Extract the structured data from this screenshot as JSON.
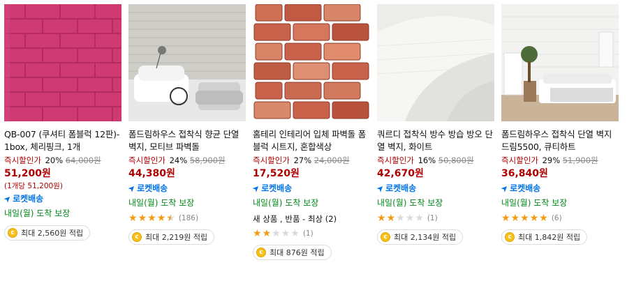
{
  "colors": {
    "sale": "#ae0000",
    "rocket": "#0073e9",
    "arrival": "#00891a",
    "star_on": "#f39b10",
    "star_off": "#dadada"
  },
  "products": [
    {
      "name": "QB-007 (쿠셔티 폼블럭 12판)-1box, 체리핑크, 1개",
      "instant_label": "즉시할인가",
      "discount_rate": "20%",
      "original_price": "64,000원",
      "sale_price": "51,200원",
      "unit_price": "(1개당 51,200원)",
      "rocket_label": "로켓배송",
      "arrival": "내일(월) 도착 보장",
      "rating": null,
      "review_count": null,
      "condition": null,
      "points": "최대 2,560원 적립"
    },
    {
      "name": "폼드림하우스 접착식 향균 단열벽지, 모티브 파벽돌",
      "instant_label": "즉시할인가",
      "discount_rate": "24%",
      "original_price": "58,900원",
      "sale_price": "44,380원",
      "unit_price": null,
      "rocket_label": "로켓배송",
      "arrival": "내일(월) 도착 보장",
      "rating": 4.5,
      "review_count": "(186)",
      "condition": null,
      "points": "최대 2,219원 적립"
    },
    {
      "name": "홈테리 인테리어 입체 파벽돌 폼블럭 시트지, 혼합색상",
      "instant_label": "즉시할인가",
      "discount_rate": "27%",
      "original_price": "24,000원",
      "sale_price": "17,520원",
      "unit_price": null,
      "rocket_label": "로켓배송",
      "arrival": "내일(월) 도착 보장",
      "rating": 2,
      "review_count": "(1)",
      "condition": "새 상품 , 반품 - 최상 (2)",
      "points": "최대 876원 적립"
    },
    {
      "name": "쿼르디 접착식 방수 방습 방오 단열 벽지, 화이트",
      "instant_label": "즉시할인가",
      "discount_rate": "16%",
      "original_price": "50,800원",
      "sale_price": "42,670원",
      "unit_price": null,
      "rocket_label": "로켓배송",
      "arrival": "내일(월) 도착 보장",
      "rating": 2,
      "review_count": "(1)",
      "condition": null,
      "points": "최대 2,134원 적립"
    },
    {
      "name": "폼드림하우스 접착식 단열 벽지 드림5500, 큐티하트",
      "instant_label": "즉시할인가",
      "discount_rate": "29%",
      "original_price": "51,900원",
      "sale_price": "36,840원",
      "unit_price": null,
      "rocket_label": "로켓배송",
      "arrival": "내일(월) 도착 보장",
      "rating": 5,
      "review_count": "(6)",
      "condition": null,
      "points": "최대 1,842원 적립"
    }
  ]
}
